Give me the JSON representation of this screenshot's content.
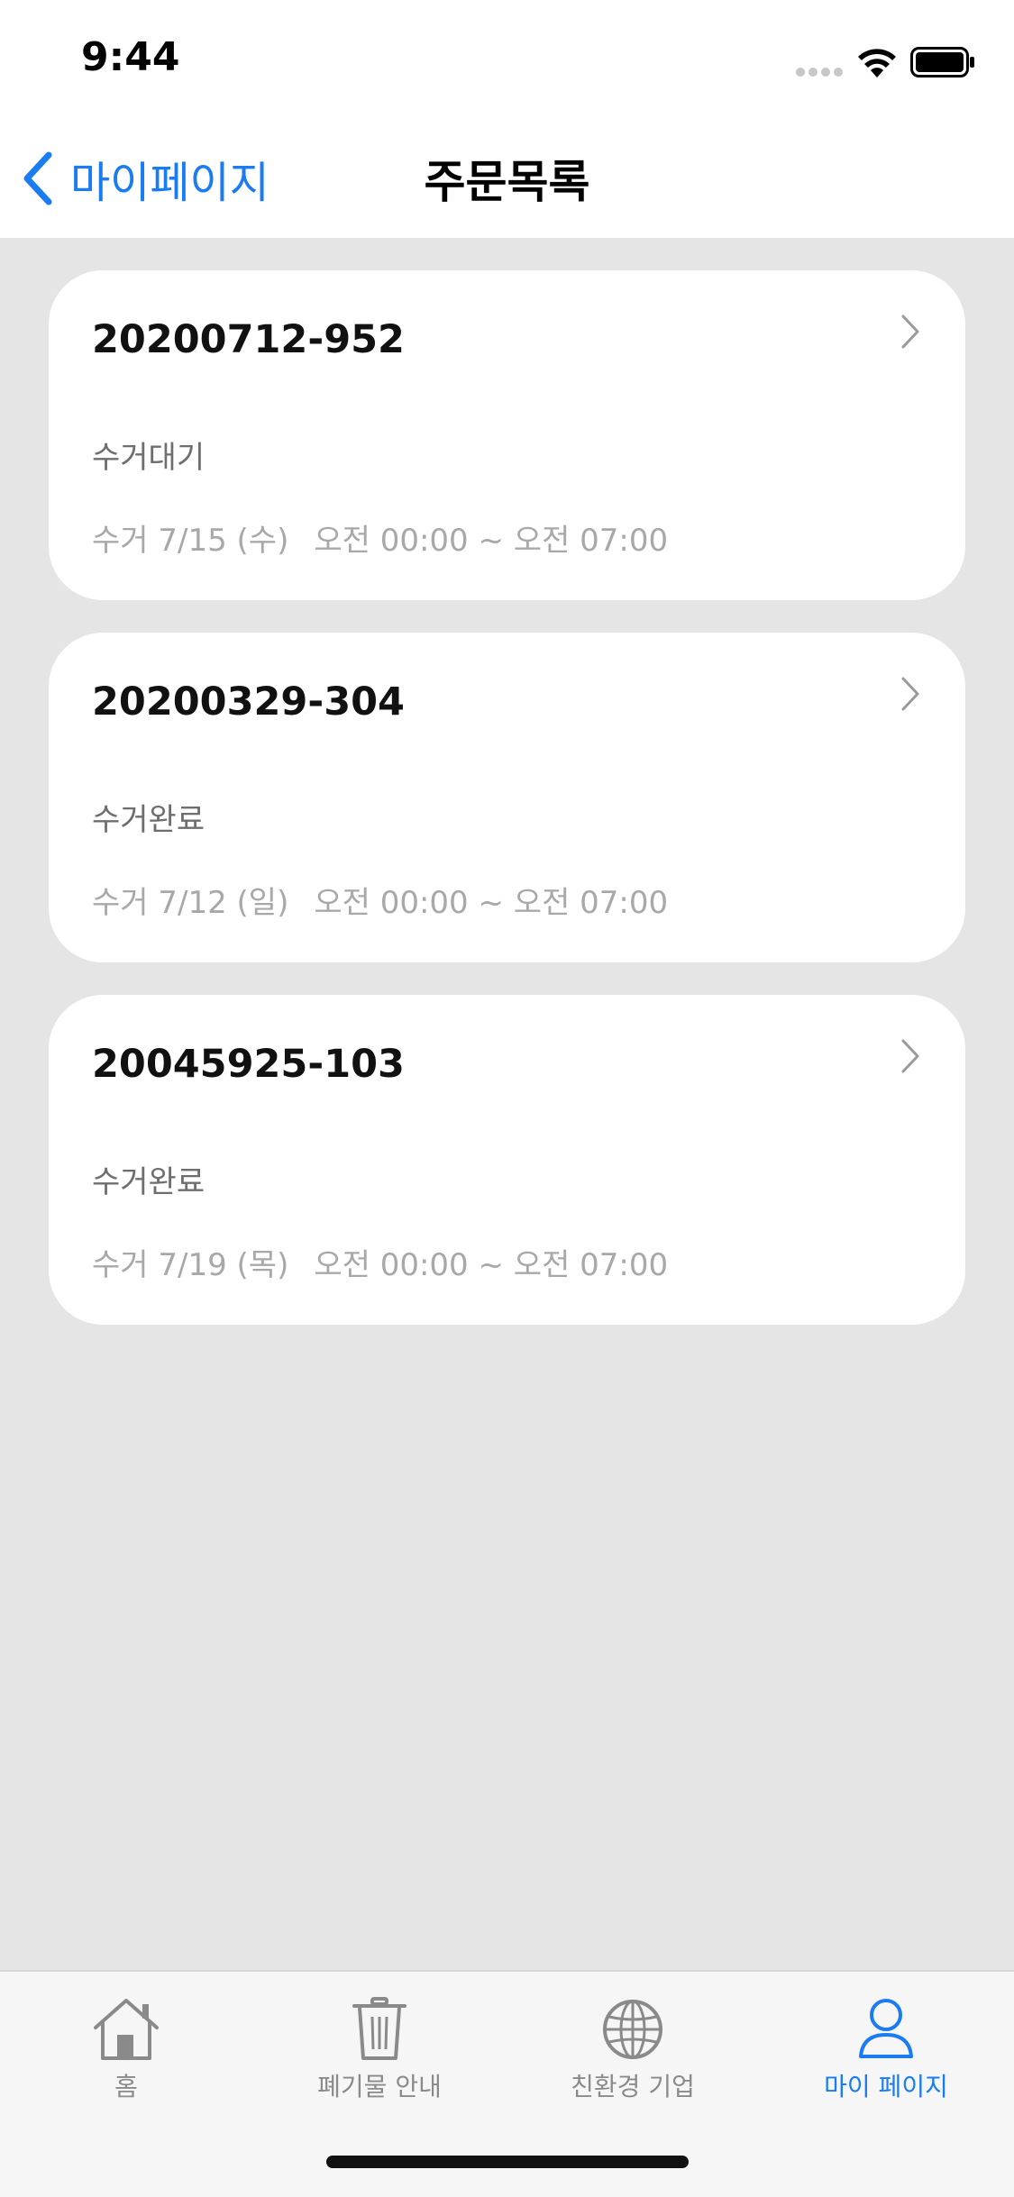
{
  "status_bar": {
    "time": "9:44"
  },
  "nav": {
    "back_label": "마이페이지",
    "title": "주문목록"
  },
  "orders": [
    {
      "number": "20200712-952",
      "status": "수거대기",
      "pickup_date": "수거 7/15 (수)",
      "time_range": "오전 00:00 ~ 오전 07:00"
    },
    {
      "number": "20200329-304",
      "status": "수거완료",
      "pickup_date": "수거 7/12 (일)",
      "time_range": "오전 00:00 ~ 오전 07:00"
    },
    {
      "number": "20045925-103",
      "status": "수거완료",
      "pickup_date": "수거 7/19 (목)",
      "time_range": "오전 00:00 ~ 오전 07:00"
    }
  ],
  "tab_bar": {
    "items": [
      {
        "label": "홈",
        "icon": "house-icon",
        "active": false
      },
      {
        "label": "폐기물 안내",
        "icon": "trash-icon",
        "active": false
      },
      {
        "label": "친환경 기업",
        "icon": "globe-icon",
        "active": false
      },
      {
        "label": "마이 페이지",
        "icon": "person-icon",
        "active": true
      }
    ]
  },
  "colors": {
    "accent": "#1a7cf3",
    "background": "#e5e5e5",
    "card": "#ffffff",
    "inactive": "#8a8a8a"
  }
}
